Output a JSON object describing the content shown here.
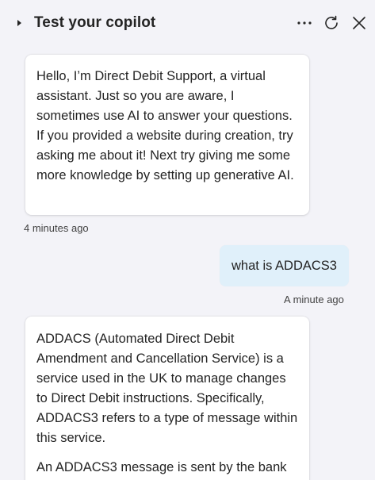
{
  "header": {
    "title": "Test your copilot",
    "icons": {
      "collapse": "chevron-right-icon",
      "more": "more-horizontal-icon",
      "refresh": "refresh-icon",
      "close": "close-icon"
    }
  },
  "messages": [
    {
      "role": "bot",
      "paragraphs": [
        "Hello, I’m Direct Debit Support, a virtual assistant. Just so you are aware, I sometimes use AI to answer your questions. If you provided a website during creation, try asking me about it! Next try giving me some more knowledge by setting up generative AI."
      ],
      "timestamp": "4 minutes ago"
    },
    {
      "role": "user",
      "text": "what is ADDACS3",
      "timestamp": "A minute ago"
    },
    {
      "role": "bot",
      "paragraphs": [
        "ADDACS (Automated Direct Debit Amendment and Cancellation Service) is a service used in the UK to manage changes to Direct Debit instructions. Specifically, ADDACS3 refers to a type of message within this service.",
        "An ADDACS3 message is sent by the bank"
      ]
    }
  ],
  "colors": {
    "background": "#f3f3f8",
    "bot_bubble": "#ffffff",
    "user_bubble": "#e0f0fa",
    "text": "#242424"
  }
}
